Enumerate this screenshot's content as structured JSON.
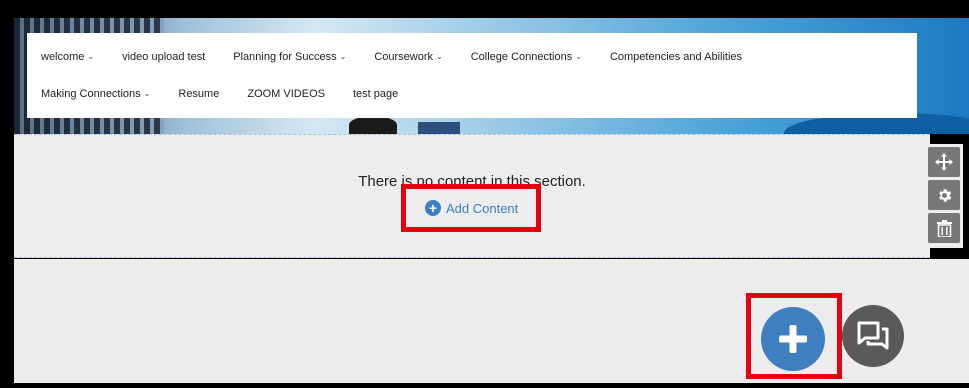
{
  "nav": {
    "row1": [
      {
        "label": "welcome",
        "dropdown": true
      },
      {
        "label": "video upload test",
        "dropdown": false
      },
      {
        "label": "Planning for Success",
        "dropdown": true
      },
      {
        "label": "Coursework",
        "dropdown": true
      },
      {
        "label": "College Connections",
        "dropdown": true
      },
      {
        "label": "Competencies and Abilities",
        "dropdown": false
      }
    ],
    "row2": [
      {
        "label": "Making Connections",
        "dropdown": true
      },
      {
        "label": "Resume",
        "dropdown": false
      },
      {
        "label": "ZOOM VIDEOS",
        "dropdown": false
      },
      {
        "label": "test page",
        "dropdown": false
      }
    ],
    "chevron_glyph": "⌄"
  },
  "section": {
    "empty_message": "There is no content in this section.",
    "add_content_label": "Add Content",
    "tools": [
      "move-icon",
      "gear-icon",
      "trash-icon"
    ]
  },
  "fab": {
    "add_icon": "plus-icon",
    "chat_icon": "chat-icon"
  },
  "colors": {
    "accent_blue": "#3f7fc0",
    "highlight_red": "#e3000f",
    "tool_gray": "#777777",
    "chat_gray": "#595959"
  }
}
